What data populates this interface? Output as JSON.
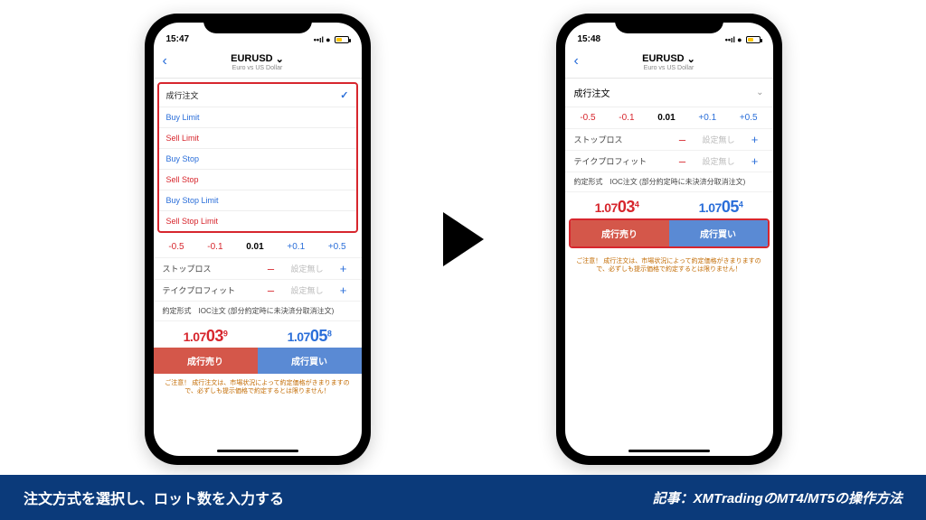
{
  "caption": {
    "left": "注文方式を選択し、ロット数を入力する",
    "right": "記事：XMTradingのMT4/MT5の操作方法"
  },
  "phone_left": {
    "status": {
      "time": "15:47"
    },
    "header": {
      "symbol": "EURUSD",
      "desc": "Euro vs US Dollar"
    },
    "order_types": [
      {
        "label": "成行注文",
        "color": "c-black",
        "selected": true
      },
      {
        "label": "Buy Limit",
        "color": "c-blue",
        "selected": false
      },
      {
        "label": "Sell Limit",
        "color": "c-red",
        "selected": false
      },
      {
        "label": "Buy Stop",
        "color": "c-blue",
        "selected": false
      },
      {
        "label": "Sell Stop",
        "color": "c-red",
        "selected": false
      },
      {
        "label": "Buy Stop Limit",
        "color": "c-blue",
        "selected": false
      },
      {
        "label": "Sell Stop Limit",
        "color": "c-red",
        "selected": false
      }
    ],
    "lot": {
      "m05": "-0.5",
      "m01": "-0.1",
      "val": "0.01",
      "p01": "+0.1",
      "p05": "+0.5"
    },
    "sl": {
      "label": "ストップロス",
      "placeholder": "設定無し"
    },
    "tp": {
      "label": "テイクプロフィット",
      "placeholder": "設定無し"
    },
    "fill": "約定形式　IOC注文 (部分約定時に未決済分取消注文)",
    "price_sell": {
      "pre": "1.07",
      "big": "03",
      "sup": "9"
    },
    "price_buy": {
      "pre": "1.07",
      "big": "05",
      "sup": "8"
    },
    "btn_sell": "成行売り",
    "btn_buy": "成行買い",
    "warning": "ご注意！ 成行注文は、市場状況によって約定価格がきまりますので、必ずしも提示価格で約定するとは限りません！"
  },
  "phone_right": {
    "status": {
      "time": "15:48"
    },
    "header": {
      "symbol": "EURUSD",
      "desc": "Euro vs US Dollar"
    },
    "order_collapsed": "成行注文",
    "lot": {
      "m05": "-0.5",
      "m01": "-0.1",
      "val": "0.01",
      "p01": "+0.1",
      "p05": "+0.5"
    },
    "sl": {
      "label": "ストップロス",
      "placeholder": "設定無し"
    },
    "tp": {
      "label": "テイクプロフィット",
      "placeholder": "設定無し"
    },
    "fill": "約定形式　IOC注文 (部分約定時に未決済分取消注文)",
    "price_sell": {
      "pre": "1.07",
      "big": "03",
      "sup": "4"
    },
    "price_buy": {
      "pre": "1.07",
      "big": "05",
      "sup": "4"
    },
    "btn_sell": "成行売り",
    "btn_buy": "成行買い",
    "warning": "ご注意！ 成行注文は、市場状況によって約定価格がきまりますので、必ずしも提示価格で約定するとは限りません！"
  }
}
